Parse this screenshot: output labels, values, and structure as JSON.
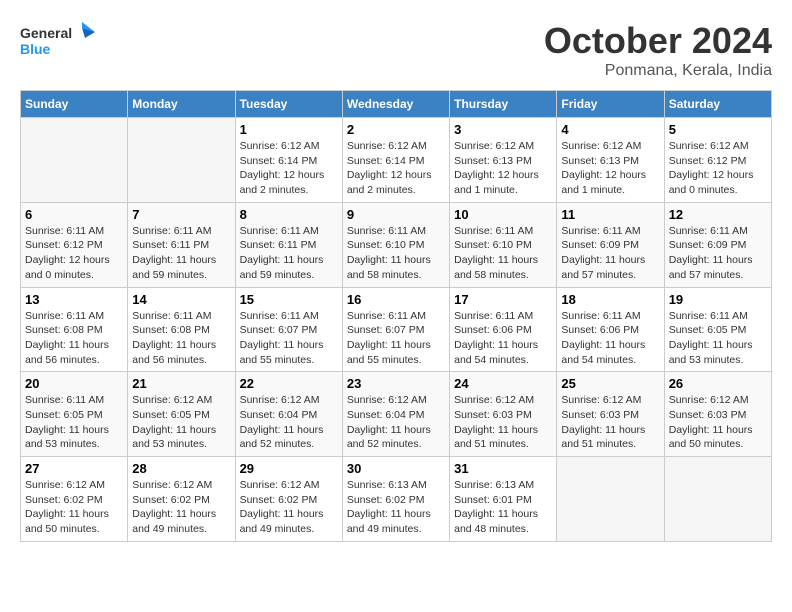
{
  "header": {
    "logo_line1": "General",
    "logo_line2": "Blue",
    "month": "October 2024",
    "location": "Ponmana, Kerala, India"
  },
  "weekdays": [
    "Sunday",
    "Monday",
    "Tuesday",
    "Wednesday",
    "Thursday",
    "Friday",
    "Saturday"
  ],
  "weeks": [
    [
      {
        "day": "",
        "empty": true
      },
      {
        "day": "",
        "empty": true
      },
      {
        "day": "1",
        "sunrise": "6:12 AM",
        "sunset": "6:14 PM",
        "daylight": "12 hours and 2 minutes."
      },
      {
        "day": "2",
        "sunrise": "6:12 AM",
        "sunset": "6:14 PM",
        "daylight": "12 hours and 2 minutes."
      },
      {
        "day": "3",
        "sunrise": "6:12 AM",
        "sunset": "6:13 PM",
        "daylight": "12 hours and 1 minute."
      },
      {
        "day": "4",
        "sunrise": "6:12 AM",
        "sunset": "6:13 PM",
        "daylight": "12 hours and 1 minute."
      },
      {
        "day": "5",
        "sunrise": "6:12 AM",
        "sunset": "6:12 PM",
        "daylight": "12 hours and 0 minutes."
      }
    ],
    [
      {
        "day": "6",
        "sunrise": "6:11 AM",
        "sunset": "6:12 PM",
        "daylight": "12 hours and 0 minutes."
      },
      {
        "day": "7",
        "sunrise": "6:11 AM",
        "sunset": "6:11 PM",
        "daylight": "11 hours and 59 minutes."
      },
      {
        "day": "8",
        "sunrise": "6:11 AM",
        "sunset": "6:11 PM",
        "daylight": "11 hours and 59 minutes."
      },
      {
        "day": "9",
        "sunrise": "6:11 AM",
        "sunset": "6:10 PM",
        "daylight": "11 hours and 58 minutes."
      },
      {
        "day": "10",
        "sunrise": "6:11 AM",
        "sunset": "6:10 PM",
        "daylight": "11 hours and 58 minutes."
      },
      {
        "day": "11",
        "sunrise": "6:11 AM",
        "sunset": "6:09 PM",
        "daylight": "11 hours and 57 minutes."
      },
      {
        "day": "12",
        "sunrise": "6:11 AM",
        "sunset": "6:09 PM",
        "daylight": "11 hours and 57 minutes."
      }
    ],
    [
      {
        "day": "13",
        "sunrise": "6:11 AM",
        "sunset": "6:08 PM",
        "daylight": "11 hours and 56 minutes."
      },
      {
        "day": "14",
        "sunrise": "6:11 AM",
        "sunset": "6:08 PM",
        "daylight": "11 hours and 56 minutes."
      },
      {
        "day": "15",
        "sunrise": "6:11 AM",
        "sunset": "6:07 PM",
        "daylight": "11 hours and 55 minutes."
      },
      {
        "day": "16",
        "sunrise": "6:11 AM",
        "sunset": "6:07 PM",
        "daylight": "11 hours and 55 minutes."
      },
      {
        "day": "17",
        "sunrise": "6:11 AM",
        "sunset": "6:06 PM",
        "daylight": "11 hours and 54 minutes."
      },
      {
        "day": "18",
        "sunrise": "6:11 AM",
        "sunset": "6:06 PM",
        "daylight": "11 hours and 54 minutes."
      },
      {
        "day": "19",
        "sunrise": "6:11 AM",
        "sunset": "6:05 PM",
        "daylight": "11 hours and 53 minutes."
      }
    ],
    [
      {
        "day": "20",
        "sunrise": "6:11 AM",
        "sunset": "6:05 PM",
        "daylight": "11 hours and 53 minutes."
      },
      {
        "day": "21",
        "sunrise": "6:12 AM",
        "sunset": "6:05 PM",
        "daylight": "11 hours and 53 minutes."
      },
      {
        "day": "22",
        "sunrise": "6:12 AM",
        "sunset": "6:04 PM",
        "daylight": "11 hours and 52 minutes."
      },
      {
        "day": "23",
        "sunrise": "6:12 AM",
        "sunset": "6:04 PM",
        "daylight": "11 hours and 52 minutes."
      },
      {
        "day": "24",
        "sunrise": "6:12 AM",
        "sunset": "6:03 PM",
        "daylight": "11 hours and 51 minutes."
      },
      {
        "day": "25",
        "sunrise": "6:12 AM",
        "sunset": "6:03 PM",
        "daylight": "11 hours and 51 minutes."
      },
      {
        "day": "26",
        "sunrise": "6:12 AM",
        "sunset": "6:03 PM",
        "daylight": "11 hours and 50 minutes."
      }
    ],
    [
      {
        "day": "27",
        "sunrise": "6:12 AM",
        "sunset": "6:02 PM",
        "daylight": "11 hours and 50 minutes."
      },
      {
        "day": "28",
        "sunrise": "6:12 AM",
        "sunset": "6:02 PM",
        "daylight": "11 hours and 49 minutes."
      },
      {
        "day": "29",
        "sunrise": "6:12 AM",
        "sunset": "6:02 PM",
        "daylight": "11 hours and 49 minutes."
      },
      {
        "day": "30",
        "sunrise": "6:13 AM",
        "sunset": "6:02 PM",
        "daylight": "11 hours and 49 minutes."
      },
      {
        "day": "31",
        "sunrise": "6:13 AM",
        "sunset": "6:01 PM",
        "daylight": "11 hours and 48 minutes."
      },
      {
        "day": "",
        "empty": true
      },
      {
        "day": "",
        "empty": true
      }
    ]
  ],
  "labels": {
    "sunrise": "Sunrise:",
    "sunset": "Sunset:",
    "daylight": "Daylight:"
  }
}
